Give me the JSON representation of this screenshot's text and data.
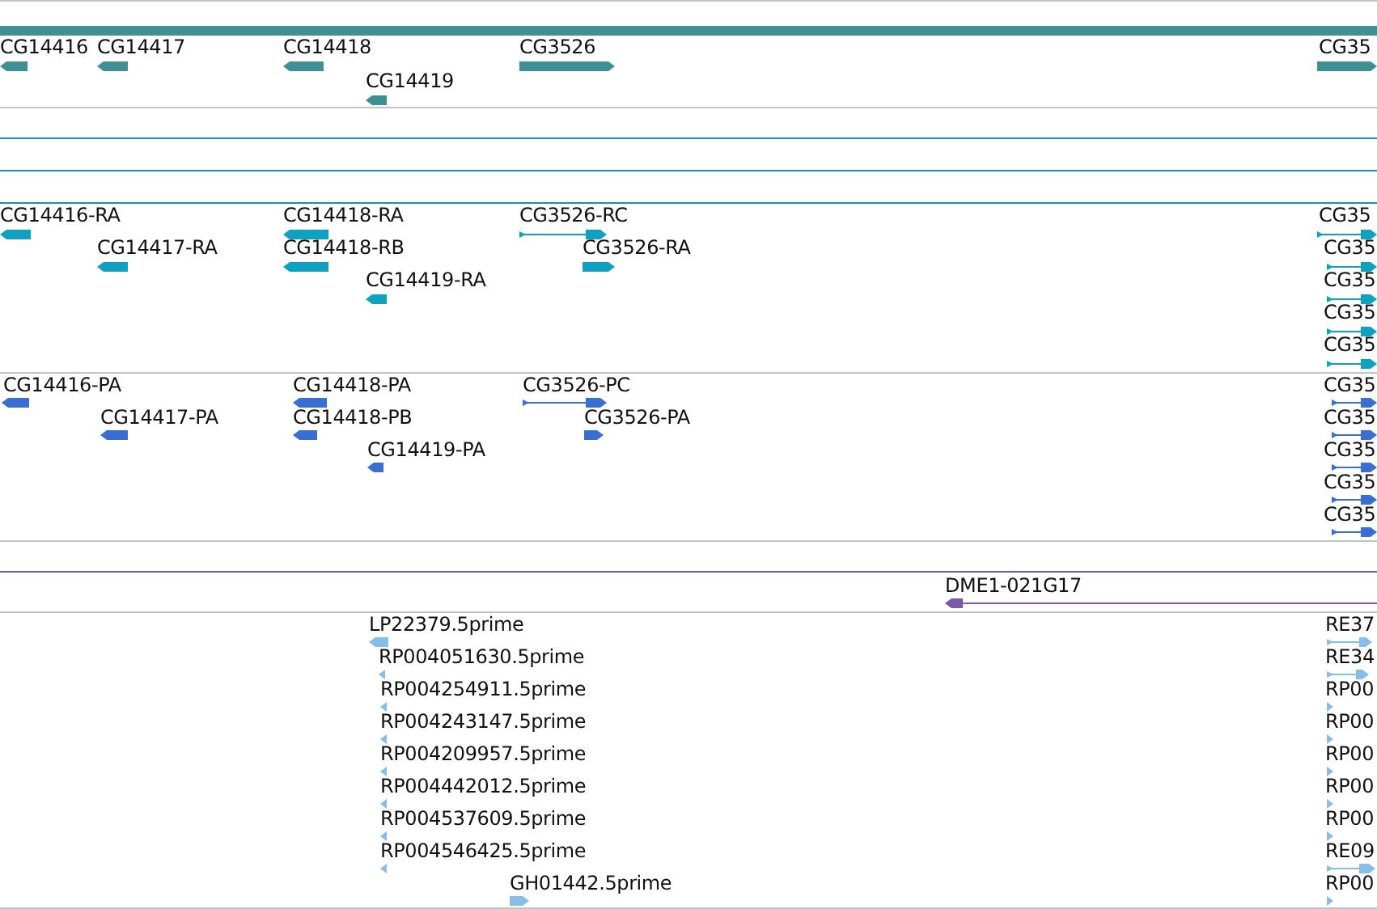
{
  "tracks": [
    {
      "color": "#3f8f94",
      "features": [
        {
          "kind": "span"
        },
        {
          "label": "CG14416",
          "kind": "block",
          "reverse": true
        },
        {
          "label": "CG14417",
          "kind": "block",
          "reverse": true
        },
        {
          "label": "CG14418",
          "kind": "block",
          "reverse": true
        },
        {
          "label": "CG14419",
          "kind": "block",
          "reverse": true
        },
        {
          "label": "CG3526",
          "kind": "block",
          "reverse": false
        },
        {
          "label": "CG35",
          "kind": "block",
          "reverse": false
        }
      ]
    },
    {
      "color": "#10a0c0",
      "features": [
        {
          "label": "CG14416-RA",
          "kind": "block",
          "reverse": true
        },
        {
          "label": "CG14417-RA",
          "kind": "block",
          "reverse": true
        },
        {
          "label": "CG14418-RA",
          "kind": "block",
          "reverse": true
        },
        {
          "label": "CG14418-RB",
          "kind": "block",
          "reverse": true
        },
        {
          "label": "CG14419-RA",
          "kind": "block",
          "reverse": true
        },
        {
          "label": "CG3526-RC",
          "kind": "spliced",
          "reverse": false
        },
        {
          "label": "CG3526-RA",
          "kind": "block",
          "reverse": false
        },
        {
          "label": "CG35",
          "kind": "spliced",
          "reverse": false
        },
        {
          "label": "CG35",
          "kind": "spliced",
          "reverse": false
        },
        {
          "label": "CG35",
          "kind": "spliced",
          "reverse": false
        },
        {
          "label": "CG35",
          "kind": "spliced",
          "reverse": false
        },
        {
          "label": "CG35",
          "kind": "spliced",
          "reverse": false
        }
      ]
    },
    {
      "color": "#3a6ed0",
      "features": [
        {
          "label": "CG14416-PA",
          "kind": "block",
          "reverse": true
        },
        {
          "label": "CG14417-PA",
          "kind": "block",
          "reverse": true
        },
        {
          "label": "CG14418-PA",
          "kind": "block",
          "reverse": true
        },
        {
          "label": "CG14418-PB",
          "kind": "block",
          "reverse": true
        },
        {
          "label": "CG14419-PA",
          "kind": "block",
          "reverse": true
        },
        {
          "label": "CG3526-PC",
          "kind": "spliced",
          "reverse": false
        },
        {
          "label": "CG3526-PA",
          "kind": "block",
          "reverse": false
        },
        {
          "label": "CG35",
          "kind": "spliced",
          "reverse": false
        },
        {
          "label": "CG35",
          "kind": "spliced",
          "reverse": false
        },
        {
          "label": "CG35",
          "kind": "spliced",
          "reverse": false
        },
        {
          "label": "CG35",
          "kind": "spliced",
          "reverse": false
        },
        {
          "label": "CG35",
          "kind": "spliced",
          "reverse": false
        }
      ]
    },
    {
      "color": "#7a5aa8",
      "features": [
        {
          "label": "DME1-021G17",
          "kind": "spliced",
          "reverse": true
        }
      ]
    },
    {
      "color": "#88bde6",
      "features": [
        {
          "label": "LP22379.5prime",
          "kind": "block",
          "reverse": true
        },
        {
          "label": "RP004051630.5prime",
          "kind": "block",
          "reverse": true
        },
        {
          "label": "RP004254911.5prime",
          "kind": "block",
          "reverse": true
        },
        {
          "label": "RP004243147.5prime",
          "kind": "block",
          "reverse": true
        },
        {
          "label": "RP004209957.5prime",
          "kind": "block",
          "reverse": true
        },
        {
          "label": "RP004442012.5prime",
          "kind": "block",
          "reverse": true
        },
        {
          "label": "RP004537609.5prime",
          "kind": "block",
          "reverse": true
        },
        {
          "label": "RP004546425.5prime",
          "kind": "block",
          "reverse": true
        },
        {
          "label": "GH01442.5prime",
          "kind": "block",
          "reverse": false
        },
        {
          "label": "RE37",
          "kind": "spliced",
          "reverse": false
        },
        {
          "label": "RE34",
          "kind": "spliced",
          "reverse": false
        },
        {
          "label": "RP00",
          "kind": "block",
          "reverse": false
        },
        {
          "label": "RP00",
          "kind": "block",
          "reverse": false
        },
        {
          "label": "RP00",
          "kind": "block",
          "reverse": false
        },
        {
          "label": "RP00",
          "kind": "block",
          "reverse": false
        },
        {
          "label": "RP00",
          "kind": "block",
          "reverse": false
        },
        {
          "label": "RE09",
          "kind": "spliced",
          "reverse": false
        },
        {
          "label": "RP00",
          "kind": "block",
          "reverse": false
        }
      ]
    }
  ]
}
